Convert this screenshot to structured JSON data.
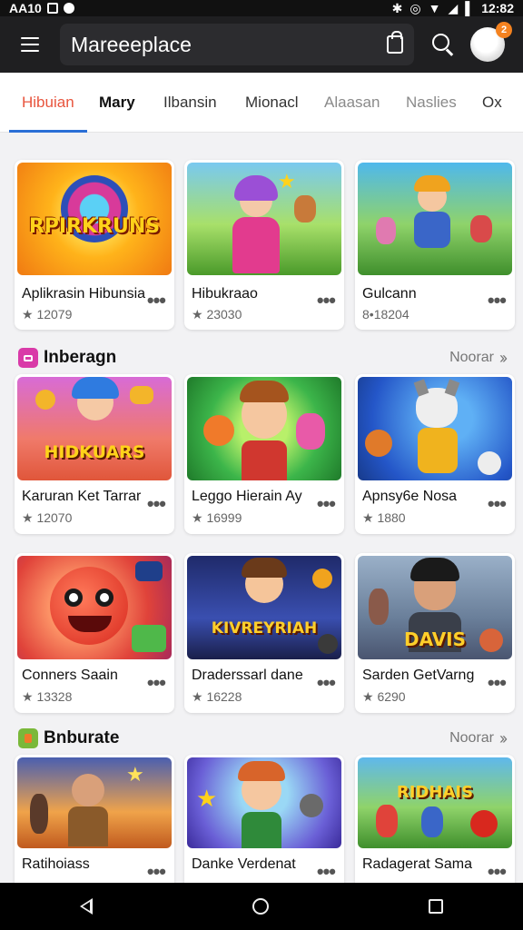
{
  "status_bar": {
    "time_left": "AA10",
    "time_right": "12:82"
  },
  "app_bar": {
    "title": "Mareeeplace",
    "notification_count": "2"
  },
  "tabs": [
    {
      "label": "Hibuian",
      "state": "active"
    },
    {
      "label": "Mary",
      "state": "bold"
    },
    {
      "label": "Ilbansin",
      "state": "normal"
    },
    {
      "label": "Mionacl",
      "state": "normal"
    },
    {
      "label": "Alaasan",
      "state": "faded"
    },
    {
      "label": "Naslies",
      "state": "faded"
    },
    {
      "label": "Ox",
      "state": "normal"
    }
  ],
  "section1": {
    "cards": [
      {
        "name": "Aplikrasin Hibunsia",
        "meta": "★ 12079",
        "art": "RPIRKRUNS"
      },
      {
        "name": "Hibukraao",
        "meta": "★ 23030",
        "art": ""
      },
      {
        "name": "Gulcann",
        "meta": "8•18204",
        "art": ""
      }
    ]
  },
  "section2": {
    "title": "Inberagn",
    "more": "Noorar",
    "cards": [
      {
        "name": "Karuran Ket Tarrar",
        "meta": "★ 12070",
        "art": "HIDKUARS"
      },
      {
        "name": "Leggo Hierain Ay",
        "meta": "★ 16999",
        "art": ""
      },
      {
        "name": "Apnsy6e Nosa",
        "meta": "★ 1880",
        "art": ""
      }
    ]
  },
  "section3": {
    "cards": [
      {
        "name": "Conners Saain",
        "meta": "★ 13328",
        "art": ""
      },
      {
        "name": "Draderssarl dane",
        "meta": "★ 16228",
        "art": "KIVREYRIAH"
      },
      {
        "name": "Sarden GetVarng",
        "meta": "★ 6290",
        "art": "DAVIS"
      }
    ]
  },
  "section4": {
    "title": "Bnburate",
    "more": "Noorar",
    "cards": [
      {
        "name": "Ratihoiass",
        "meta": "",
        "art": ""
      },
      {
        "name": "Danke Verdenat",
        "meta": "",
        "art": ""
      },
      {
        "name": "Radagerat Sama",
        "meta": "",
        "art": "RIDHAIS"
      }
    ]
  }
}
